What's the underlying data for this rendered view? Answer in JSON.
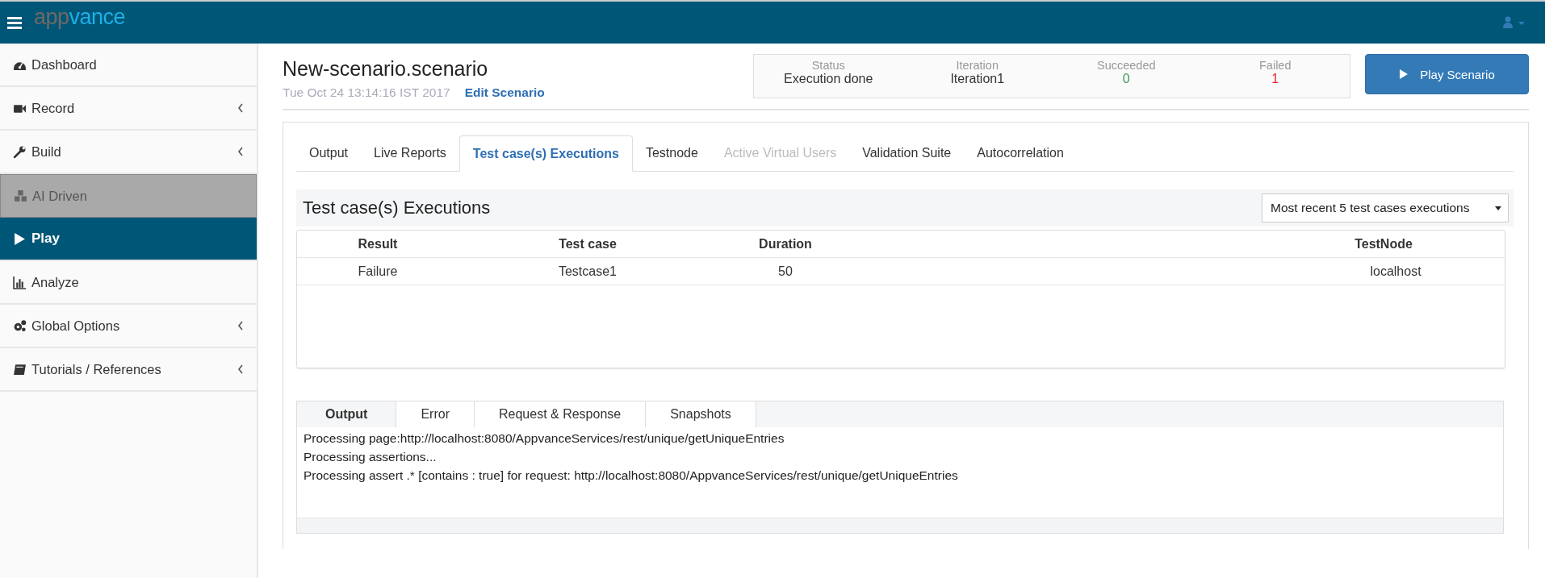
{
  "topbar": {
    "logo_first": "app",
    "logo_second": "vance"
  },
  "sidebar": {
    "items": [
      {
        "label": "Dashboard",
        "selected": false,
        "disabled": false,
        "expandable": false
      },
      {
        "label": "Record",
        "selected": false,
        "disabled": false,
        "expandable": true
      },
      {
        "label": "Build",
        "selected": false,
        "disabled": false,
        "expandable": true
      },
      {
        "label": "AI Driven",
        "selected": false,
        "disabled": true,
        "expandable": false
      },
      {
        "label": "Play",
        "selected": true,
        "disabled": false,
        "expandable": false
      },
      {
        "label": "Analyze",
        "selected": false,
        "disabled": false,
        "expandable": false
      },
      {
        "label": "Global Options",
        "selected": false,
        "disabled": false,
        "expandable": true
      },
      {
        "label": "Tutorials / References",
        "selected": false,
        "disabled": false,
        "expandable": true
      }
    ]
  },
  "header": {
    "title": "New-scenario.scenario",
    "date": "Tue Oct 24 13:14:16 IST 2017",
    "edit_link": "Edit Scenario"
  },
  "status": [
    {
      "label": "Status",
      "value": "Execution done",
      "color": "#333333"
    },
    {
      "label": "Iteration",
      "value": "Iteration1",
      "color": "#333333"
    },
    {
      "label": "Succeeded",
      "value": "0",
      "color": "#3d9a5b"
    },
    {
      "label": "Failed",
      "value": "1",
      "color": "#e8262d"
    }
  ],
  "play_button": "Play Scenario",
  "tabs": [
    {
      "label": "Output",
      "selected": false,
      "disabled": false
    },
    {
      "label": "Live Reports",
      "selected": false,
      "disabled": false
    },
    {
      "label": "Test case(s) Executions",
      "selected": true,
      "disabled": false
    },
    {
      "label": "Testnode",
      "selected": false,
      "disabled": false
    },
    {
      "label": "Active Virtual Users",
      "selected": false,
      "disabled": true
    },
    {
      "label": "Validation Suite",
      "selected": false,
      "disabled": false
    },
    {
      "label": "Autocorrelation",
      "selected": false,
      "disabled": false
    }
  ],
  "executions": {
    "title": "Test case(s) Executions",
    "filter": "Most recent 5 test cases executions",
    "columns": [
      "Result",
      "Test case",
      "Duration",
      "TestNode"
    ],
    "rows": [
      [
        "Failure",
        "Testcase1",
        "50",
        "localhost"
      ]
    ]
  },
  "output_tabs": [
    {
      "label": "Output",
      "selected": true
    },
    {
      "label": "Error",
      "selected": false
    },
    {
      "label": "Request & Response",
      "selected": false
    },
    {
      "label": "Snapshots",
      "selected": false
    }
  ],
  "output_lines": [
    "Processing page:http://localhost:8080/AppvanceServices/rest/unique/getUniqueEntries",
    "Processing assertions...",
    "Processing assert .* [contains : true] for request: http://localhost:8080/AppvanceServices/rest/unique/getUniqueEntries"
  ]
}
